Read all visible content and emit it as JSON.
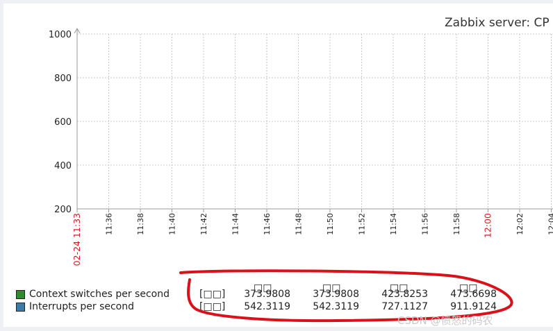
{
  "title": "Zabbix server: CP",
  "chart_data": {
    "type": "line",
    "title": "Zabbix server: CP",
    "y_ticks": [
      1000,
      800,
      600,
      400,
      200
    ],
    "ylim": [
      200,
      1000
    ],
    "x_ticks": [
      "02-24 11:33",
      "11:36",
      "11:38",
      "11:40",
      "11:42",
      "11:44",
      "11:46",
      "11:48",
      "11:50",
      "11:52",
      "11:54",
      "11:56",
      "11:58",
      "12:00",
      "12:02",
      "12:04"
    ],
    "x_ticks_highlight": [
      "02-24 11:33",
      "12:00"
    ],
    "grid": true,
    "series": [
      {
        "name": "Context switches per second",
        "color": "#2e8b2e",
        "values": []
      },
      {
        "name": "Interrupts per second",
        "color": "#3d7aa8",
        "values": []
      }
    ]
  },
  "legend": {
    "headers": [
      "□□",
      "□□",
      "□□",
      "□□"
    ],
    "rows": [
      {
        "label": "Context switches per second",
        "func": "[□□]",
        "color": "#2e8b2e",
        "values": [
          "373.9808",
          "373.9808",
          "423.8253",
          "473.6698"
        ]
      },
      {
        "label": "Interrupts per second",
        "func": "[□□]",
        "color": "#3d7aa8",
        "values": [
          "542.3119",
          "542.3119",
          "727.1127",
          "911.9124"
        ]
      }
    ]
  },
  "annotation_color": "#d9111a",
  "watermark": "CSDN @愤怒的码农"
}
